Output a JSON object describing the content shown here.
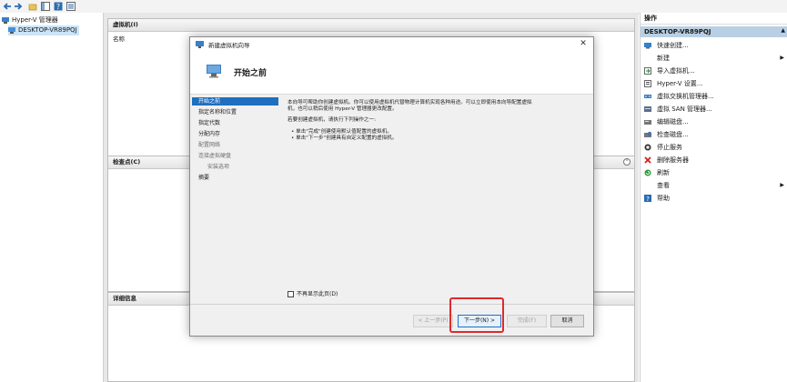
{
  "toolbar": {
    "icons": [
      "back-arrow-icon",
      "forward-arrow-icon",
      "up-folder-icon",
      "show-hide-tree-icon",
      "help-icon",
      "properties-icon"
    ]
  },
  "tree": {
    "root_label": "Hyper-V 管理器",
    "server_label": "DESKTOP-VR89PQJ"
  },
  "center": {
    "vm_panel_title": "虚拟机(I)",
    "vm_column_name": "名称",
    "checkpoint_panel_title": "检查点(C)",
    "details_panel_title": "详细信息"
  },
  "actions": {
    "title": "操作",
    "group_label": "DESKTOP-VR89PQJ",
    "items": [
      {
        "label": "快速创建...",
        "icon": "quick-create-icon"
      },
      {
        "label": "新建",
        "icon": "",
        "submenu": true
      },
      {
        "label": "导入虚拟机...",
        "icon": "import-vm-icon"
      },
      {
        "label": "Hyper-V 设置...",
        "icon": "hyperv-settings-icon"
      },
      {
        "label": "虚拟交换机管理器...",
        "icon": "virtual-switch-icon"
      },
      {
        "label": "虚拟 SAN 管理器...",
        "icon": "virtual-san-icon"
      },
      {
        "label": "编辑磁盘...",
        "icon": "edit-disk-icon"
      },
      {
        "label": "检查磁盘...",
        "icon": "inspect-disk-icon"
      },
      {
        "label": "停止服务",
        "icon": "stop-service-icon"
      },
      {
        "label": "删除服务器",
        "icon": "remove-server-icon"
      },
      {
        "label": "刷新",
        "icon": "refresh-icon"
      },
      {
        "label": "查看",
        "icon": "",
        "submenu": true
      },
      {
        "label": "帮助",
        "icon": "help-icon"
      }
    ]
  },
  "dialog": {
    "title": "新建虚拟机向导",
    "heading": "开始之前",
    "steps": [
      {
        "label": "开始之前",
        "state": "current"
      },
      {
        "label": "指定名称和位置",
        "state": "normal"
      },
      {
        "label": "指定代数",
        "state": "normal"
      },
      {
        "label": "分配内存",
        "state": "normal"
      },
      {
        "label": "配置网络",
        "state": "dim"
      },
      {
        "label": "连接虚拟硬盘",
        "state": "dim"
      },
      {
        "label": "安装选项",
        "state": "dim-sub"
      },
      {
        "label": "摘要",
        "state": "normal"
      }
    ],
    "paragraph_line1": "本向导可帮助你创建虚拟机。你可以使用虚拟机代替物理计算机实现各种用途。可以立即使用本向导配置虚拟",
    "paragraph_line2": "机，也可以稍后使用 Hyper-V 管理器更改配置。",
    "instruction": "若要创建虚拟机，请执行下列操作之一:",
    "bullet1": "• 单击\"完成\"创建使用默认值配置的虚拟机。",
    "bullet2": "• 单击\"下一步\"创建具有自定义配置的虚拟机。",
    "dont_show_label": "不再显示此页(D)",
    "buttons": {
      "previous": "< 上一步(P)",
      "next": "下一步(N) >",
      "finish": "完成(F)",
      "cancel": "取消"
    }
  },
  "colors": {
    "highlight_box": "#e0292d",
    "step_selected": "#1f6fc0",
    "actions_group_bg": "#b9cfe3"
  }
}
